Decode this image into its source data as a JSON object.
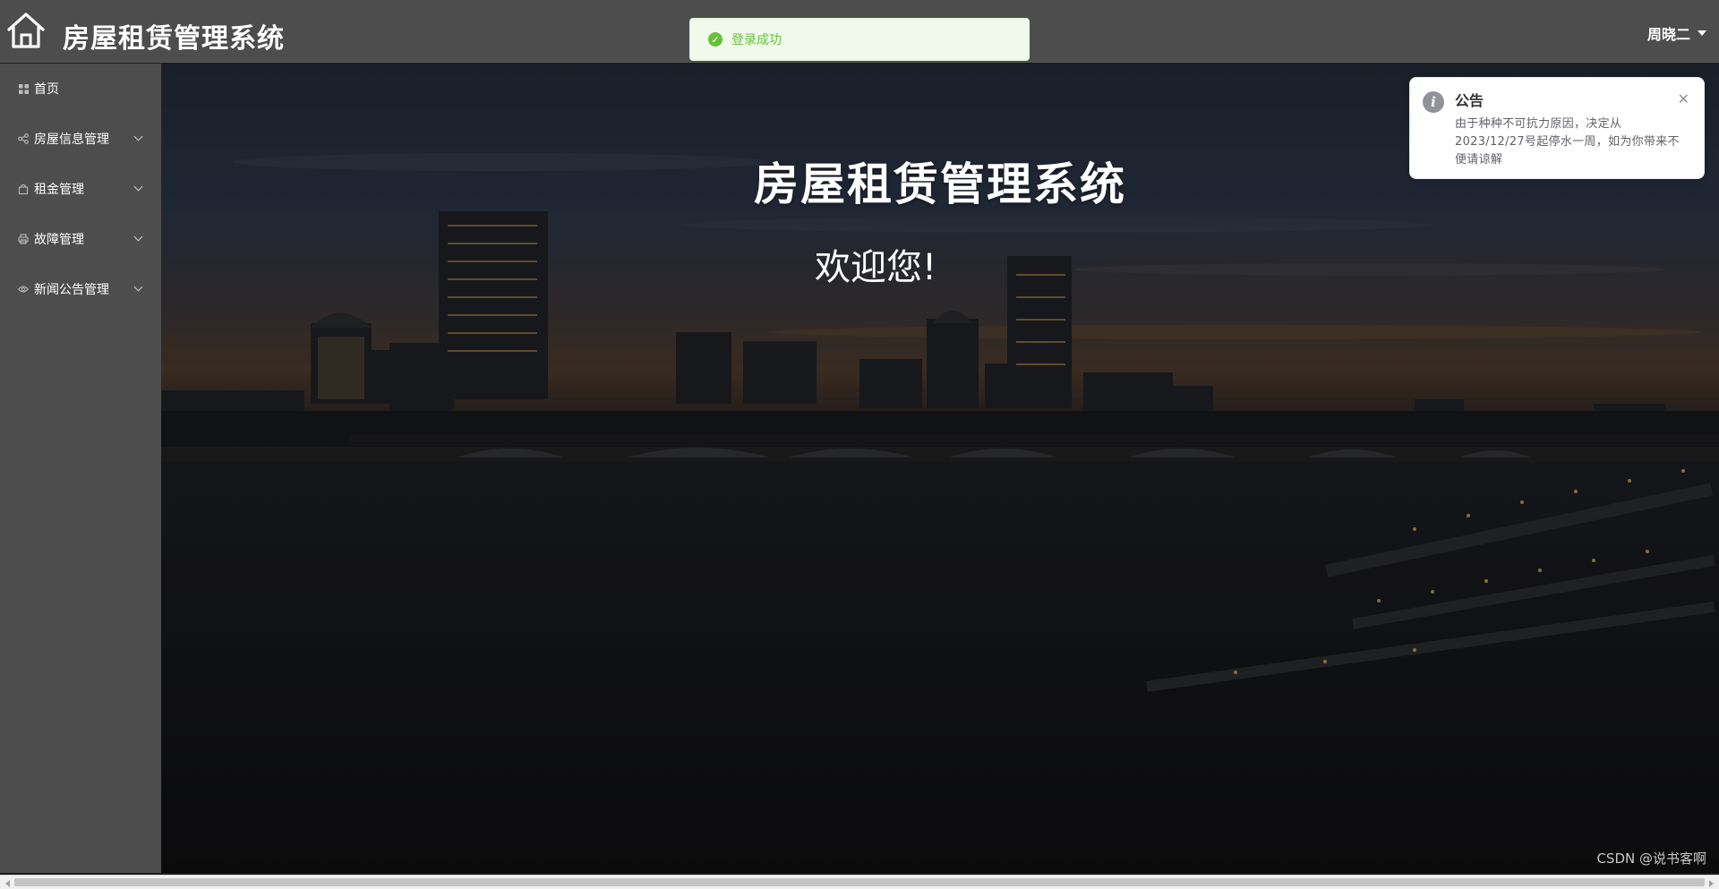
{
  "header": {
    "title": "房屋租赁管理系统",
    "home_icon": "home-icon",
    "user_name": "周晓二",
    "user_menu_icon": "caret-down-icon"
  },
  "toast": {
    "text": "登录成功",
    "icon": "check-circle-icon",
    "color": "#67c23a"
  },
  "sidebar": {
    "items": [
      {
        "label": "首页",
        "icon": "grid-icon",
        "expandable": false
      },
      {
        "label": "房屋信息管理",
        "icon": "share-icon",
        "expandable": true
      },
      {
        "label": "租金管理",
        "icon": "bag-icon",
        "expandable": true
      },
      {
        "label": "故障管理",
        "icon": "printer-icon",
        "expandable": true
      },
      {
        "label": "新闻公告管理",
        "icon": "eye-icon",
        "expandable": true
      }
    ]
  },
  "main": {
    "title": "房屋租赁管理系统",
    "subtitle": "欢迎您!",
    "watermark": "CSDN @说书客啊"
  },
  "notification": {
    "title": "公告",
    "body": "由于种种不可抗力原因，决定从2023/12/27号起停水一周，如为你带来不便请谅解",
    "icon": "info-icon",
    "close_icon": "close-icon"
  },
  "colors": {
    "header_bg": "#4d4d4d",
    "sidebar_bg": "#4d4d4d",
    "toast_bg": "#f0f9eb"
  }
}
